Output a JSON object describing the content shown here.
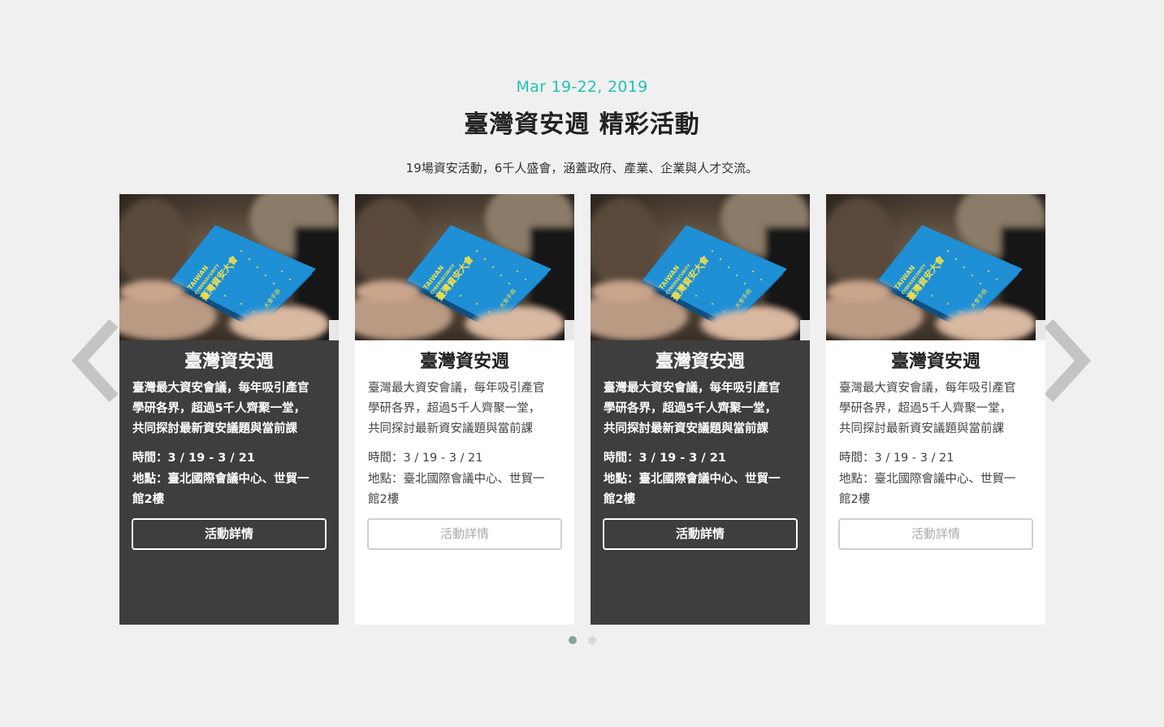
{
  "header": {
    "date": "Mar 19-22, 2019",
    "title": "臺灣資安週 精彩活動",
    "subtitle": "19場資安活動，6千人盛會，涵蓋政府、產業、企業與人才交流。"
  },
  "colors": {
    "accent": "#20c2b4",
    "dark_card": "#3e3e3e",
    "light_card": "#ffffff",
    "book_blue": "#1f8fd6",
    "background": "#f0f0f0"
  },
  "cards": [
    {
      "variant": "dark",
      "image_alt": "book-photo",
      "title": "臺灣資安週",
      "desc_line1": "臺灣最大資安會議，每年吸引產官",
      "desc_line2": "學研各界，超過5千人齊聚一堂，",
      "desc_line3": "共同探討最新資安議題與當前課",
      "time": "時間：3 / 19 - 3 / 21",
      "place_line1": "地點：臺北國際會議中心、世貿一",
      "place_line2": "館2樓",
      "button": "活動詳情"
    },
    {
      "variant": "light",
      "image_alt": "book-photo",
      "title": "臺灣資安週",
      "desc_line1": "臺灣最大資安會議，每年吸引產官",
      "desc_line2": "學研各界，超過5千人齊聚一堂，",
      "desc_line3": "共同探討最新資安議題與當前課",
      "time": "時間：3 / 19 - 3 / 21",
      "place_line1": "地點：臺北國際會議中心、世貿一",
      "place_line2": "館2樓",
      "button": "活動詳情"
    },
    {
      "variant": "dark",
      "image_alt": "book-photo",
      "title": "臺灣資安週",
      "desc_line1": "臺灣最大資安會議，每年吸引產官",
      "desc_line2": "學研各界，超過5千人齊聚一堂，",
      "desc_line3": "共同探討最新資安議題與當前課",
      "time": "時間：3 / 19 - 3 / 21",
      "place_line1": "地點：臺北國際會議中心、世貿一",
      "place_line2": "館2樓",
      "button": "活動詳情"
    },
    {
      "variant": "light",
      "image_alt": "book-photo",
      "title": "臺灣資安週",
      "desc_line1": "臺灣最大資安會議，每年吸引產官",
      "desc_line2": "學研各界，超過5千人齊聚一堂，",
      "desc_line3": "共同探討最新資安議題與當前課",
      "time": "時間：3 / 19 - 3 / 21",
      "place_line1": "地點：臺北國際會議中心、世貿一",
      "place_line2": "館2樓",
      "button": "活動詳情"
    }
  ],
  "book_cover_text": {
    "line1": "TAIWAN",
    "line2": "CYBERSECURITY",
    "line3": "臺灣資安大會",
    "line4": "大會手冊"
  },
  "navigation": {
    "prev_icon": "chevron-left-icon",
    "next_icon": "chevron-right-icon"
  },
  "pagination": {
    "total": 2,
    "active": 1
  }
}
